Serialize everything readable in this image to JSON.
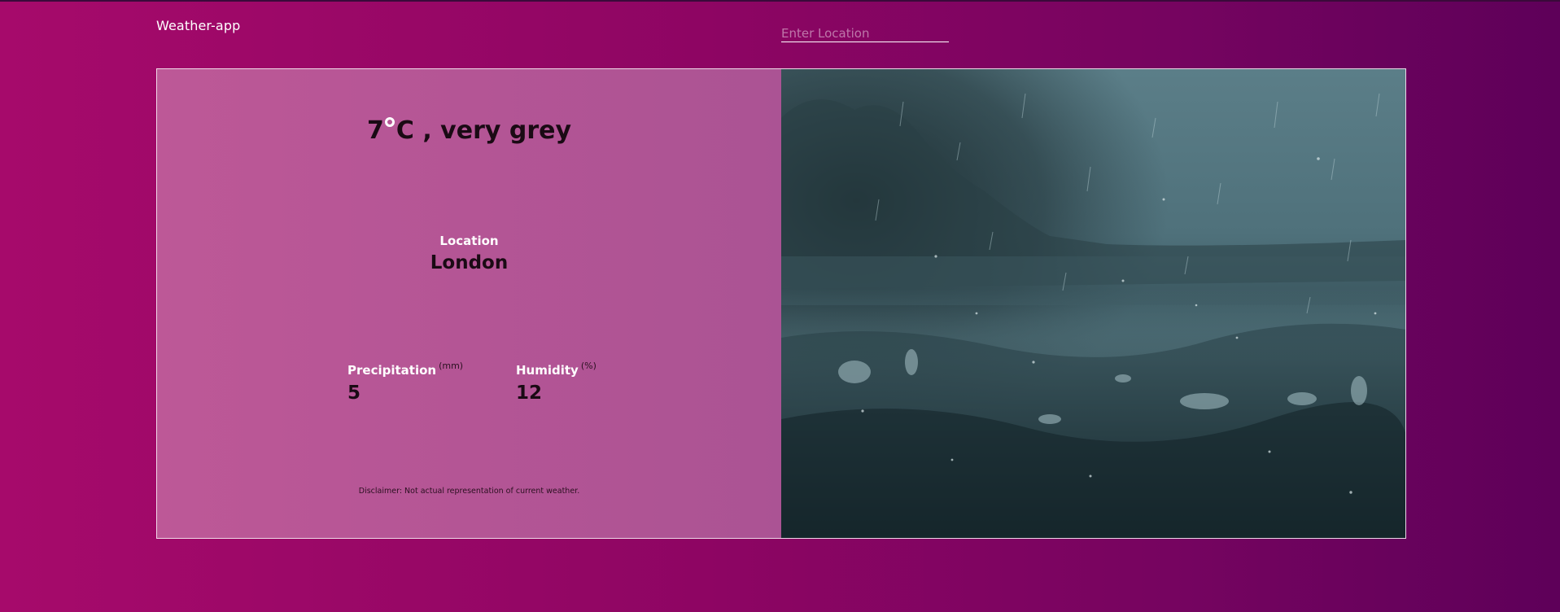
{
  "header": {
    "brand": "Weather-app",
    "search_placeholder": "Enter Location"
  },
  "weather": {
    "temperature": "7",
    "unit": "C",
    "condition": " , very grey",
    "location_label": "Location",
    "location_value": "London",
    "precipitation_label": "Precipitation",
    "precipitation_unit": "(mm)",
    "precipitation_value": "5",
    "humidity_label": "Humidity",
    "humidity_unit": "(%)",
    "humidity_value": "12",
    "disclaimer": "Disclaimer: Not actual representation of current weather."
  },
  "colors": {
    "background_start": "#a60a6b",
    "background_end": "#5e0059",
    "panel": "#b45595",
    "photo_tint": "#4e6e78"
  }
}
